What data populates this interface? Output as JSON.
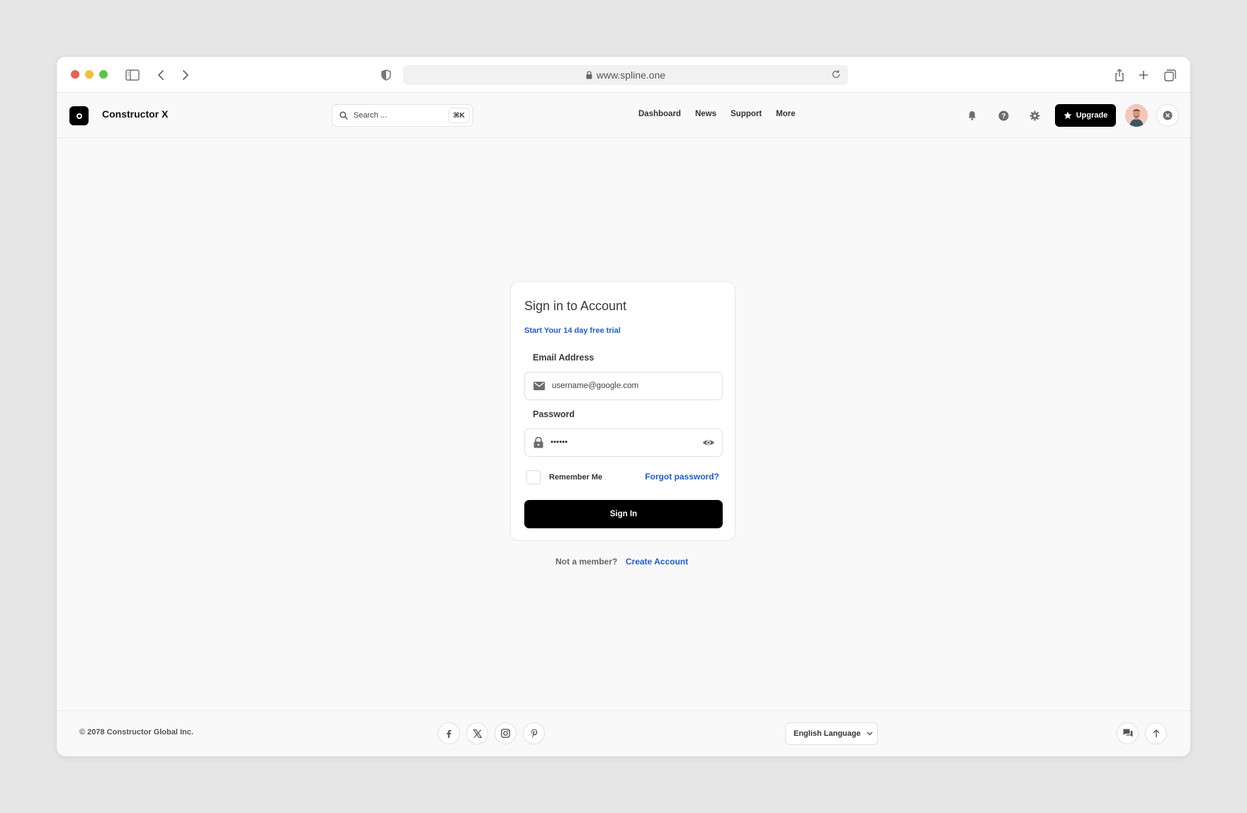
{
  "browser": {
    "url": "www.spline.one",
    "icons": [
      "sidebar-icon",
      "back-icon",
      "forward-icon",
      "shield-icon",
      "lock-icon",
      "reload-icon",
      "share-icon",
      "new-tab-icon",
      "tabs-icon"
    ]
  },
  "header": {
    "brand": "Constructor X",
    "search_placeholder": "Search ...",
    "search_shortcut": "⌘K",
    "nav": [
      "Dashboard",
      "News",
      "Support",
      "More"
    ],
    "upgrade_label": "Upgrade",
    "icons": [
      "bell-icon",
      "help-icon",
      "gear-icon",
      "star-icon",
      "close-icon"
    ]
  },
  "signin": {
    "title": "Sign in to Account",
    "trial_link": "Start Your 14 day free trial",
    "email_label": "Email Address",
    "email_placeholder": "username@google.com",
    "password_label": "Password",
    "password_value": "••••••",
    "remember_label": "Remember Me",
    "forgot_link": "Forgot password?",
    "submit_label": "Sign In",
    "not_member": "Not a member?",
    "create_link": "Create Account"
  },
  "footer": {
    "copyright": "© 2078 Constructor Global Inc.",
    "socials": [
      "facebook-icon",
      "x-icon",
      "instagram-icon",
      "pinterest-icon"
    ],
    "language": "English Language"
  },
  "colors": {
    "accent": "#1f5bd8",
    "primary_button": "#000000",
    "page_bg": "#f9f9f9",
    "outer_bg": "#e6e6e6"
  }
}
